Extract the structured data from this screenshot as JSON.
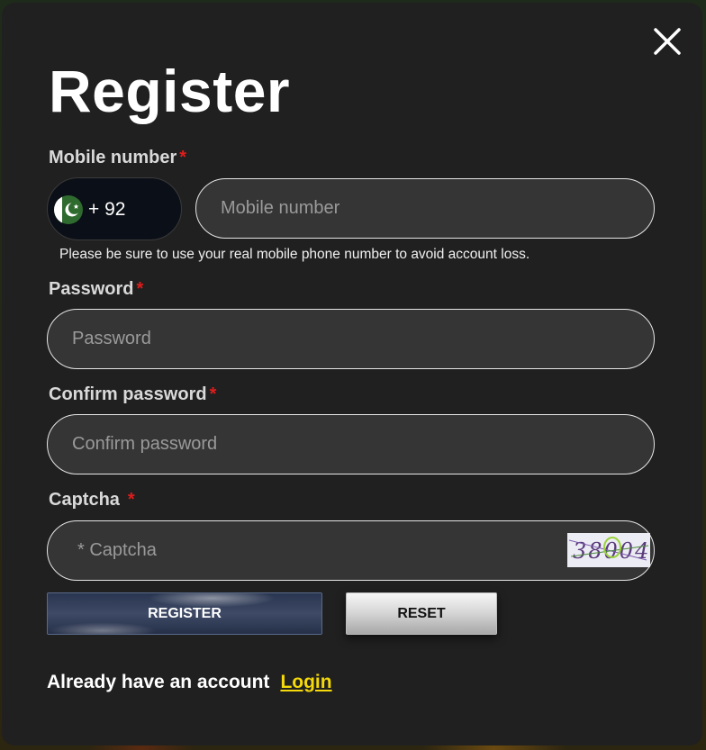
{
  "modal": {
    "title": "Register",
    "required_mark": "*"
  },
  "mobile": {
    "label": "Mobile number",
    "country_code": "+ 92",
    "country_flag": "pakistan-flag",
    "placeholder": "Mobile number",
    "value": "",
    "hint": "Please be sure to use your real mobile phone number to avoid account loss."
  },
  "password": {
    "label": "Password",
    "placeholder": "Password",
    "value": ""
  },
  "confirm_password": {
    "label": "Confirm password",
    "placeholder": "Confirm password",
    "value": ""
  },
  "captcha": {
    "label": "Captcha",
    "placeholder": "* Captcha",
    "value": "",
    "image_text": "38004"
  },
  "buttons": {
    "register": "REGISTER",
    "reset": "RESET"
  },
  "footer": {
    "text": "Already have an account",
    "login": "Login"
  },
  "colors": {
    "modal_bg": "#202020",
    "field_bg": "#353535",
    "required": "#e01c1c",
    "link": "#f5d90a"
  }
}
